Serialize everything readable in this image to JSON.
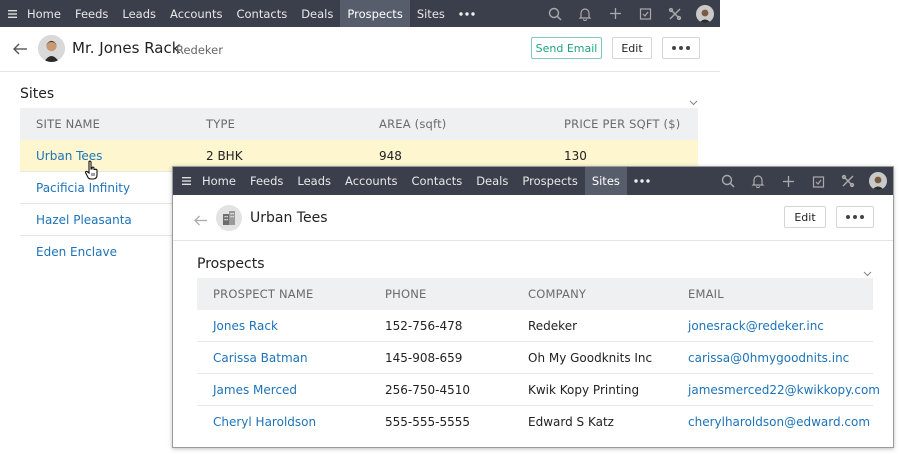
{
  "nav": {
    "items": [
      "Home",
      "Feeds",
      "Leads",
      "Accounts",
      "Contacts",
      "Deals",
      "Prospects",
      "Sites"
    ],
    "active_main": "Prospects",
    "active_overlay": "Sites"
  },
  "record": {
    "name": "Mr. Jones Rack",
    "company": "Redeker",
    "send_email_label": "Send Email",
    "edit_label": "Edit"
  },
  "sites": {
    "title": "Sites",
    "columns": [
      "SITE NAME",
      "TYPE",
      "AREA (sqft)",
      "PRICE PER SQFT ($)"
    ],
    "rows": [
      {
        "name": "Urban Tees",
        "type": "2 BHK",
        "area": "948",
        "price": "130"
      },
      {
        "name": "Pacificia Infinity",
        "type": "",
        "area": "",
        "price": ""
      },
      {
        "name": "Hazel Pleasanta",
        "type": "",
        "area": "",
        "price": ""
      },
      {
        "name": "Eden Enclave",
        "type": "",
        "area": "",
        "price": ""
      }
    ]
  },
  "overlay": {
    "title": "Urban Tees",
    "edit_label": "Edit",
    "prospects_title": "Prospects",
    "columns": [
      "PROSPECT NAME",
      "PHONE",
      "COMPANY",
      "EMAIL"
    ],
    "rows": [
      {
        "name": "Jones Rack",
        "phone": "152-756-478",
        "company": "Redeker",
        "email": "jonesrack@redeker.inc"
      },
      {
        "name": "Carissa Batman",
        "phone": "145-908-659",
        "company": "Oh My Goodknits Inc",
        "email": "carissa@0hmygoodnits.inc"
      },
      {
        "name": "James Merced",
        "phone": "256-750-4510",
        "company": "Kwik Kopy Printing",
        "email": "jamesmerced22@kwikkopy.com"
      },
      {
        "name": "Cheryl Haroldson",
        "phone": "555-555-5555",
        "company": "Edward S Katz",
        "email": "cherylharoldson@edward.com"
      }
    ]
  },
  "colors": {
    "nav_bg": "#3a3f4b",
    "nav_active": "#575d6b",
    "link": "#1e73b8",
    "accent_green": "#1fa47f",
    "row_highlight": "#fdf6cf"
  }
}
